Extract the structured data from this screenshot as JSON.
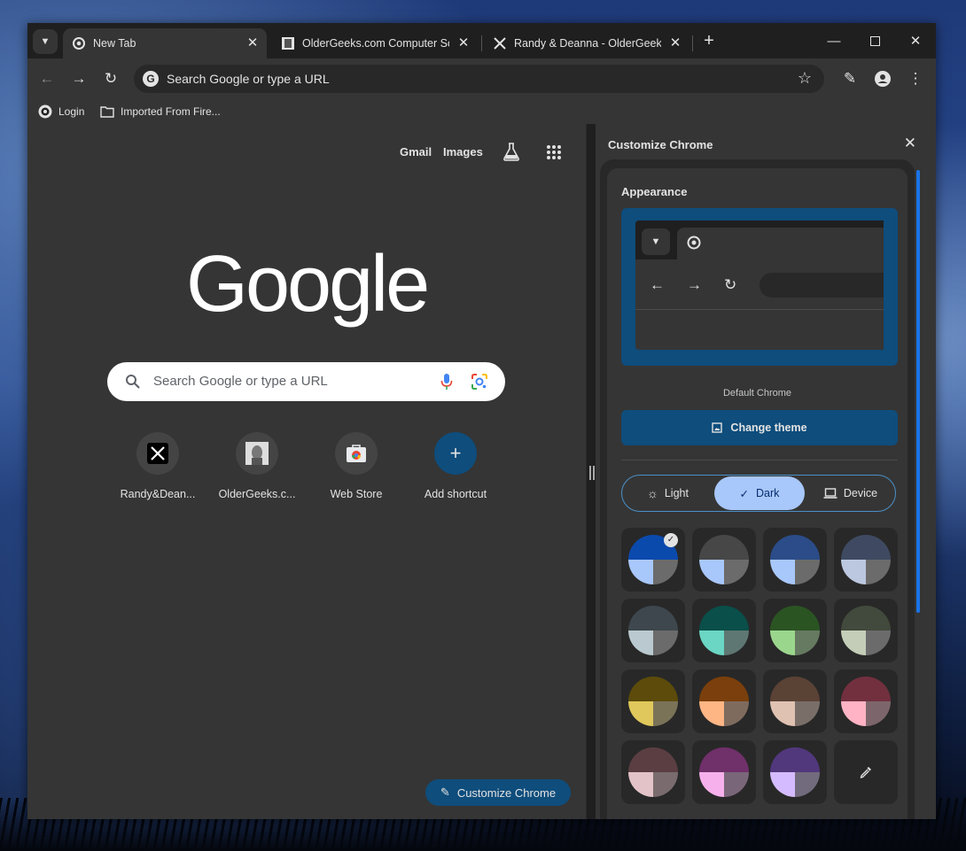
{
  "tabs": [
    {
      "title": "New Tab",
      "active": true
    },
    {
      "title": "OlderGeeks.com Computer Software",
      "active": false
    },
    {
      "title": "Randy & Deanna - OlderGeeks.com",
      "active": false
    }
  ],
  "omnibox": {
    "placeholder": "Search Google or type a URL"
  },
  "bookmarks": [
    {
      "label": "Login"
    },
    {
      "label": "Imported From Fire..."
    }
  ],
  "ntp": {
    "links": {
      "gmail": "Gmail",
      "images": "Images"
    },
    "logo": "Google",
    "search_placeholder": "Search Google or type a URL",
    "shortcuts": [
      {
        "label": "Randy&Dean..."
      },
      {
        "label": "OlderGeeks.c..."
      },
      {
        "label": "Web Store"
      },
      {
        "label": "Add shortcut"
      }
    ],
    "customize_button": "Customize Chrome"
  },
  "side_panel": {
    "title": "Customize Chrome",
    "appearance_heading": "Appearance",
    "theme_caption": "Default Chrome",
    "change_theme": "Change theme",
    "mode_options": {
      "light": "Light",
      "dark": "Dark",
      "device": "Device"
    },
    "selected_mode": "Dark"
  },
  "colors": {
    "accent": "#0e4d7c",
    "toolbar": "#353535",
    "frame": "#1f1f1f",
    "selected_segment": "#a8c7fa"
  },
  "swatches": [
    {
      "top": "#0b4aad",
      "left": "#a8c7fa",
      "right": "#6b6b6b",
      "selected": true
    },
    {
      "top": "#474747",
      "left": "#a8c7fa",
      "right": "#6b6b6b"
    },
    {
      "top": "#2b4c88",
      "left": "#a8c7fa",
      "right": "#6b6b6b"
    },
    {
      "top": "#3f4a62",
      "left": "#bcc7e0",
      "right": "#6b6b6b"
    },
    {
      "top": "#3d474d",
      "left": "#b9c9cf",
      "right": "#6b6b6b"
    },
    {
      "top": "#0a4f49",
      "left": "#6ad6c3",
      "right": "#5e7772"
    },
    {
      "top": "#2b5423",
      "left": "#9bd68d",
      "right": "#667a61"
    },
    {
      "top": "#414a3c",
      "left": "#c4cdb8",
      "right": "#6b6b6b"
    },
    {
      "top": "#5c4b0a",
      "left": "#e0c85c",
      "right": "#7a7358"
    },
    {
      "top": "#7a3f0c",
      "left": "#ffb685",
      "right": "#7f6b5e"
    },
    {
      "top": "#5a4235",
      "left": "#e0c2b3",
      "right": "#7a6e68"
    },
    {
      "top": "#72303f",
      "left": "#ffb3c4",
      "right": "#7d666b"
    },
    {
      "top": "#5a3e42",
      "left": "#e3c3c8",
      "right": "#7a6c6e"
    },
    {
      "top": "#70306a",
      "left": "#f6b1ec",
      "right": "#7a6679"
    },
    {
      "top": "#51377c",
      "left": "#d4bbff",
      "right": "#726b7d"
    },
    {
      "custom": true,
      "icon": "eyedropper-icon"
    }
  ]
}
